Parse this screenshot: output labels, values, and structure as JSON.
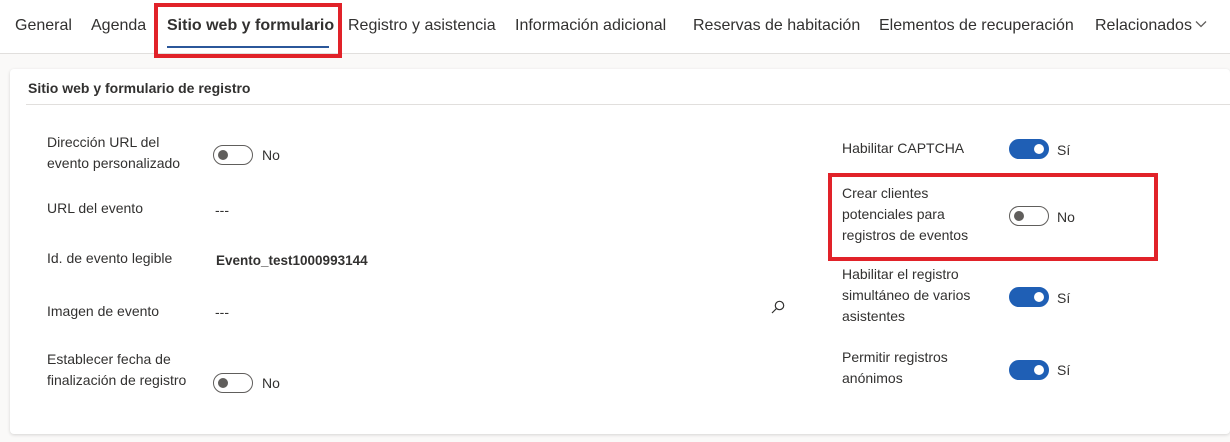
{
  "tabs": [
    {
      "label": "General"
    },
    {
      "label": "Agenda"
    },
    {
      "label": "Sitio web y formulario",
      "active": true
    },
    {
      "label": "Registro y asistencia"
    },
    {
      "label": "Información adicional"
    },
    {
      "label": "Reservas de habitación"
    },
    {
      "label": "Elementos de recuperación"
    },
    {
      "label": "Relacionados"
    }
  ],
  "section": {
    "title": "Sitio web y formulario de registro"
  },
  "left_fields": {
    "custom_url": {
      "label": "Dirección URL del evento personalizado",
      "toggle": "off",
      "state_text": "No"
    },
    "event_url": {
      "label": "URL del evento",
      "value": "---"
    },
    "readable_id": {
      "label": "Id. de evento legible",
      "value": "Evento_test1000993144"
    },
    "event_image": {
      "label": "Imagen de evento",
      "value": "---"
    },
    "set_end_date": {
      "label": "Establecer fecha de finalización de registro",
      "toggle": "off",
      "state_text": "No"
    }
  },
  "right_fields": {
    "captcha": {
      "label": "Habilitar CAPTCHA",
      "toggle": "on",
      "state_text": "Sí"
    },
    "create_leads": {
      "label": "Crear clientes potenciales para registros de eventos",
      "toggle": "off",
      "state_text": "No"
    },
    "multi_attendee": {
      "label": "Habilitar el registro simultáneo de varios asistentes",
      "toggle": "on",
      "state_text": "Sí"
    },
    "anonymous": {
      "label": "Permitir registros anónimos",
      "toggle": "on",
      "state_text": "Sí"
    }
  },
  "colors": {
    "highlight": "#e12229",
    "toggle_on": "#1f5fb5",
    "active_tab_underline": "#2b579a"
  },
  "icons": {
    "related_dropdown": "chevron-down-icon",
    "image_lookup": "search-icon"
  }
}
